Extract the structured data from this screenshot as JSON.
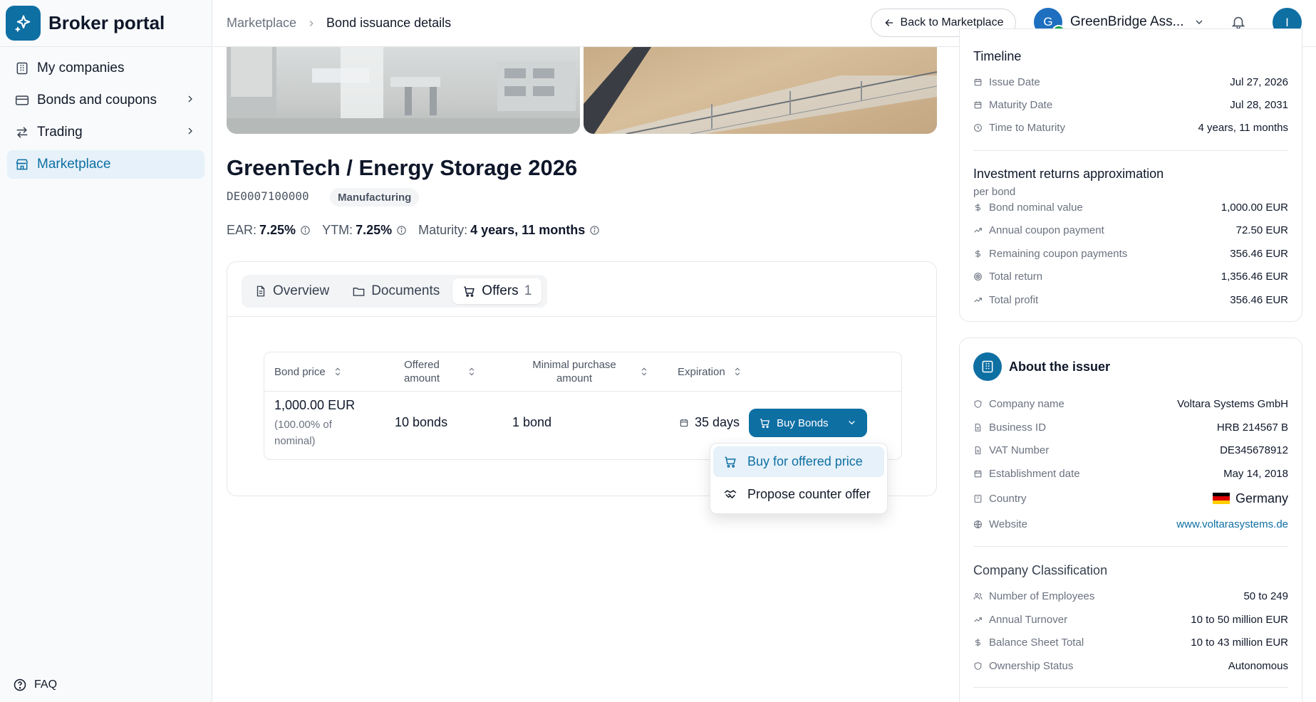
{
  "sidebar": {
    "brand_title": "Broker portal",
    "items": [
      {
        "label": "My companies",
        "icon": "building-icon"
      },
      {
        "label": "Bonds and coupons",
        "icon": "card-icon"
      },
      {
        "label": "Trading",
        "icon": "arrows-icon"
      },
      {
        "label": "Marketplace",
        "icon": "store-icon",
        "active": true
      }
    ],
    "faq_label": "FAQ"
  },
  "header": {
    "breadcrumb_root": "Marketplace",
    "breadcrumb_current": "Bond issuance details",
    "back_label": "Back to Marketplace",
    "org_initial": "G",
    "org_name": "GreenBridge Ass...",
    "user_initial": "I"
  },
  "bond": {
    "title": "GreenTech / Energy Storage 2026",
    "isin": "DE0007100000",
    "category": "Manufacturing",
    "ear_label": "EAR:",
    "ear_value": "7.25%",
    "ytm_label": "YTM:",
    "ytm_value": "7.25%",
    "maturity_label": "Maturity:",
    "maturity_value": "4 years, 11 months"
  },
  "tabs": {
    "overview": "Overview",
    "documents": "Documents",
    "offers": "Offers",
    "offers_count": "1"
  },
  "offers_table": {
    "headers": {
      "bond_price": "Bond price",
      "offered_amount_1": "Offered",
      "offered_amount_2": "amount",
      "min_purchase_1": "Minimal purchase",
      "min_purchase_2": "amount",
      "expiration": "Expiration"
    },
    "rows": [
      {
        "price": "1,000.00 EUR",
        "price_note_1": "(100.00% of",
        "price_note_2": "nominal)",
        "offered": "10 bonds",
        "min_purchase": "1 bond",
        "expiration": "35 days",
        "action": "Buy Bonds"
      }
    ]
  },
  "buy_menu": {
    "buy_offered": "Buy for offered price",
    "counter_offer": "Propose counter offer"
  },
  "timeline": {
    "title": "Timeline",
    "issue_date_label": "Issue Date",
    "issue_date": "Jul 27, 2026",
    "maturity_date_label": "Maturity Date",
    "maturity_date": "Jul 28, 2031",
    "ttm_label": "Time to Maturity",
    "ttm": "4 years, 11 months"
  },
  "returns": {
    "title": "Investment returns approximation",
    "subtitle": "per bond",
    "nominal_label": "Bond nominal value",
    "nominal": "1,000.00 EUR",
    "coupon_label": "Annual coupon payment",
    "coupon": "72.50 EUR",
    "remaining_label": "Remaining coupon payments",
    "remaining": "356.46 EUR",
    "total_return_label": "Total return",
    "total_return": "1,356.46 EUR",
    "total_profit_label": "Total profit",
    "total_profit": "356.46 EUR"
  },
  "issuer": {
    "title": "About the issuer",
    "company_name_label": "Company name",
    "company_name": "Voltara Systems GmbH",
    "business_id_label": "Business ID",
    "business_id": "HRB 214567 B",
    "vat_label": "VAT Number",
    "vat": "DE345678912",
    "established_label": "Establishment date",
    "established": "May 14, 2018",
    "country_label": "Country",
    "country": "Germany",
    "website_label": "Website",
    "website": "www.voltarasystems.de"
  },
  "classification": {
    "title": "Company Classification",
    "employees_label": "Number of Employees",
    "employees": "50 to 249",
    "turnover_label": "Annual Turnover",
    "turnover": "10 to 50 million EUR",
    "balance_label": "Balance Sheet Total",
    "balance": "10 to 43 million EUR",
    "ownership_label": "Ownership Status",
    "ownership": "Autonomous"
  },
  "colors": {
    "accent": "#0e6fa3",
    "accent_light": "#e6f1f9",
    "verified": "#16a34a"
  }
}
